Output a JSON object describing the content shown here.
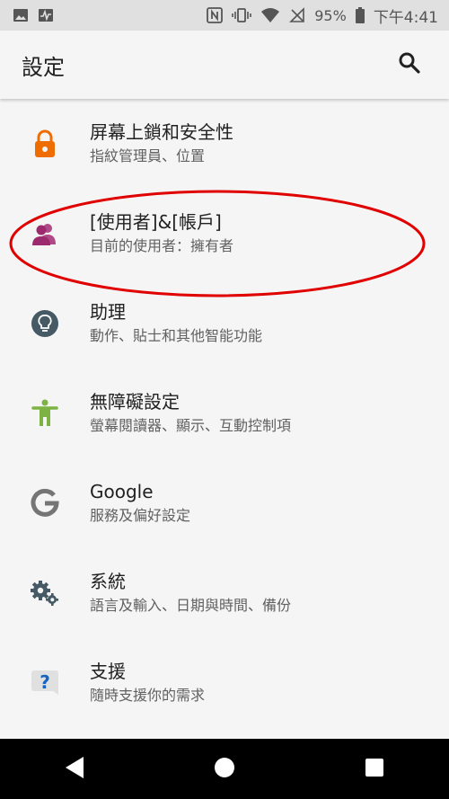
{
  "status_bar": {
    "battery_percent": "95%",
    "time": "下午4:41"
  },
  "app_bar": {
    "title": "設定"
  },
  "settings": [
    {
      "label": "屏幕上鎖和安全性",
      "sub": "指紋管理員、位置",
      "icon": "lock-icon",
      "color": "#ef6c00"
    },
    {
      "label": "[使用者]&[帳戶]",
      "sub": "目前的使用者：擁有者",
      "icon": "users-icon",
      "color": "#9c2a6e"
    },
    {
      "label": "助理",
      "sub": "動作、貼士和其他智能功能",
      "icon": "lightbulb-icon",
      "color": "#455a64"
    },
    {
      "label": "無障礙設定",
      "sub": "螢幕閱讀器、顯示、互動控制項",
      "icon": "accessibility-icon",
      "color": "#7cb342"
    },
    {
      "label": "Google",
      "sub": "服務及偏好設定",
      "icon": "google-icon",
      "color": "#757575"
    },
    {
      "label": "系統",
      "sub": "語言及輸入、日期與時間、備份",
      "icon": "gears-icon",
      "color": "#455a64"
    },
    {
      "label": "支援",
      "sub": "隨時支援你的需求",
      "icon": "help-icon",
      "color": "#1565c0"
    }
  ],
  "annotation_color": "#e00000"
}
